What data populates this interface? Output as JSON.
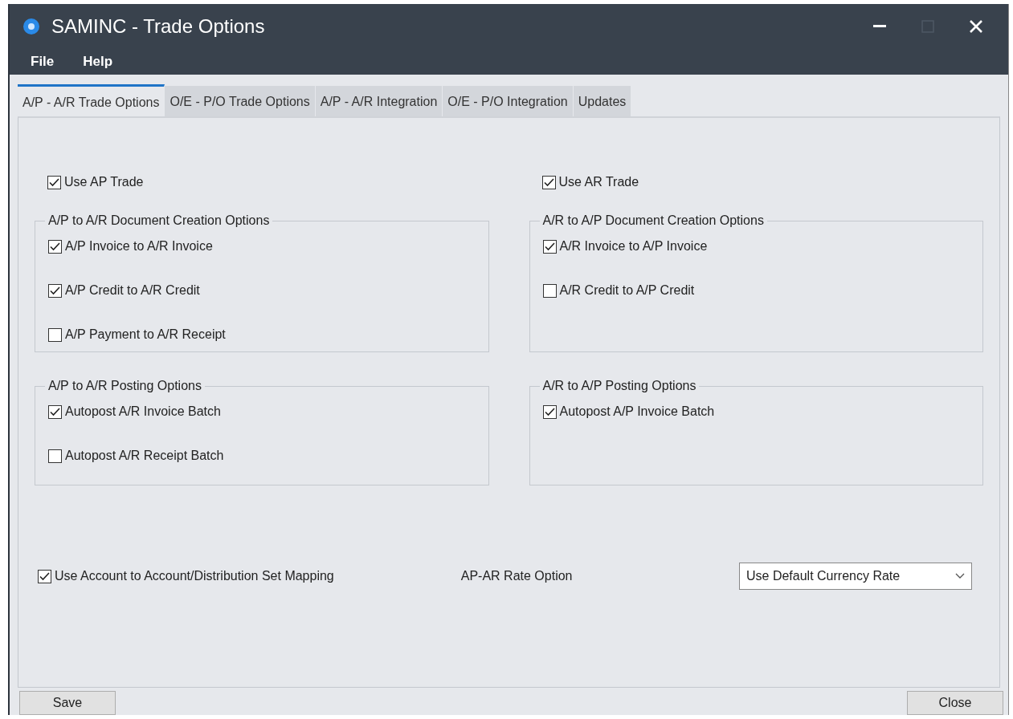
{
  "window": {
    "title": "SAMINC - Trade Options"
  },
  "menu": [
    "File",
    "Help"
  ],
  "tabs": [
    {
      "label": "A/P - A/R Trade Options",
      "selected": true
    },
    {
      "label": "O/E - P/O Trade Options",
      "selected": false
    },
    {
      "label": "A/P - A/R Integration",
      "selected": false
    },
    {
      "label": "O/E - P/O Integration",
      "selected": false
    },
    {
      "label": "Updates",
      "selected": false
    }
  ],
  "columns": [
    {
      "trade": {
        "label": "Use AP Trade",
        "checked": true
      },
      "groups": [
        {
          "title": "A/P to A/R Document Creation Options",
          "options": [
            {
              "label": "A/P Invoice to A/R Invoice",
              "checked": true
            },
            {
              "label": "A/P Credit to A/R Credit",
              "checked": true
            },
            {
              "label": "A/P Payment to A/R Receipt",
              "checked": false
            }
          ]
        },
        {
          "title": "A/P to A/R Posting Options",
          "options": [
            {
              "label": "Autopost A/R Invoice Batch",
              "checked": true
            },
            {
              "label": "Autopost A/R Receipt Batch",
              "checked": false
            }
          ]
        }
      ]
    },
    {
      "trade": {
        "label": "Use AR Trade",
        "checked": true
      },
      "groups": [
        {
          "title": "A/R to A/P Document Creation Options",
          "options": [
            {
              "label": "A/R Invoice to A/P Invoice",
              "checked": true
            },
            {
              "label": "A/R Credit to A/P Credit",
              "checked": false
            }
          ]
        },
        {
          "title": "A/R to A/P Posting Options",
          "options": [
            {
              "label": "Autopost A/P Invoice Batch",
              "checked": true
            }
          ]
        }
      ]
    }
  ],
  "mapping": {
    "label": "Use Account to Account/Distribution Set Mapping",
    "checked": true
  },
  "rate_option": {
    "label": "AP-AR Rate Option",
    "value": "Use Default Currency Rate"
  },
  "buttons": [
    "Save",
    "Close"
  ]
}
